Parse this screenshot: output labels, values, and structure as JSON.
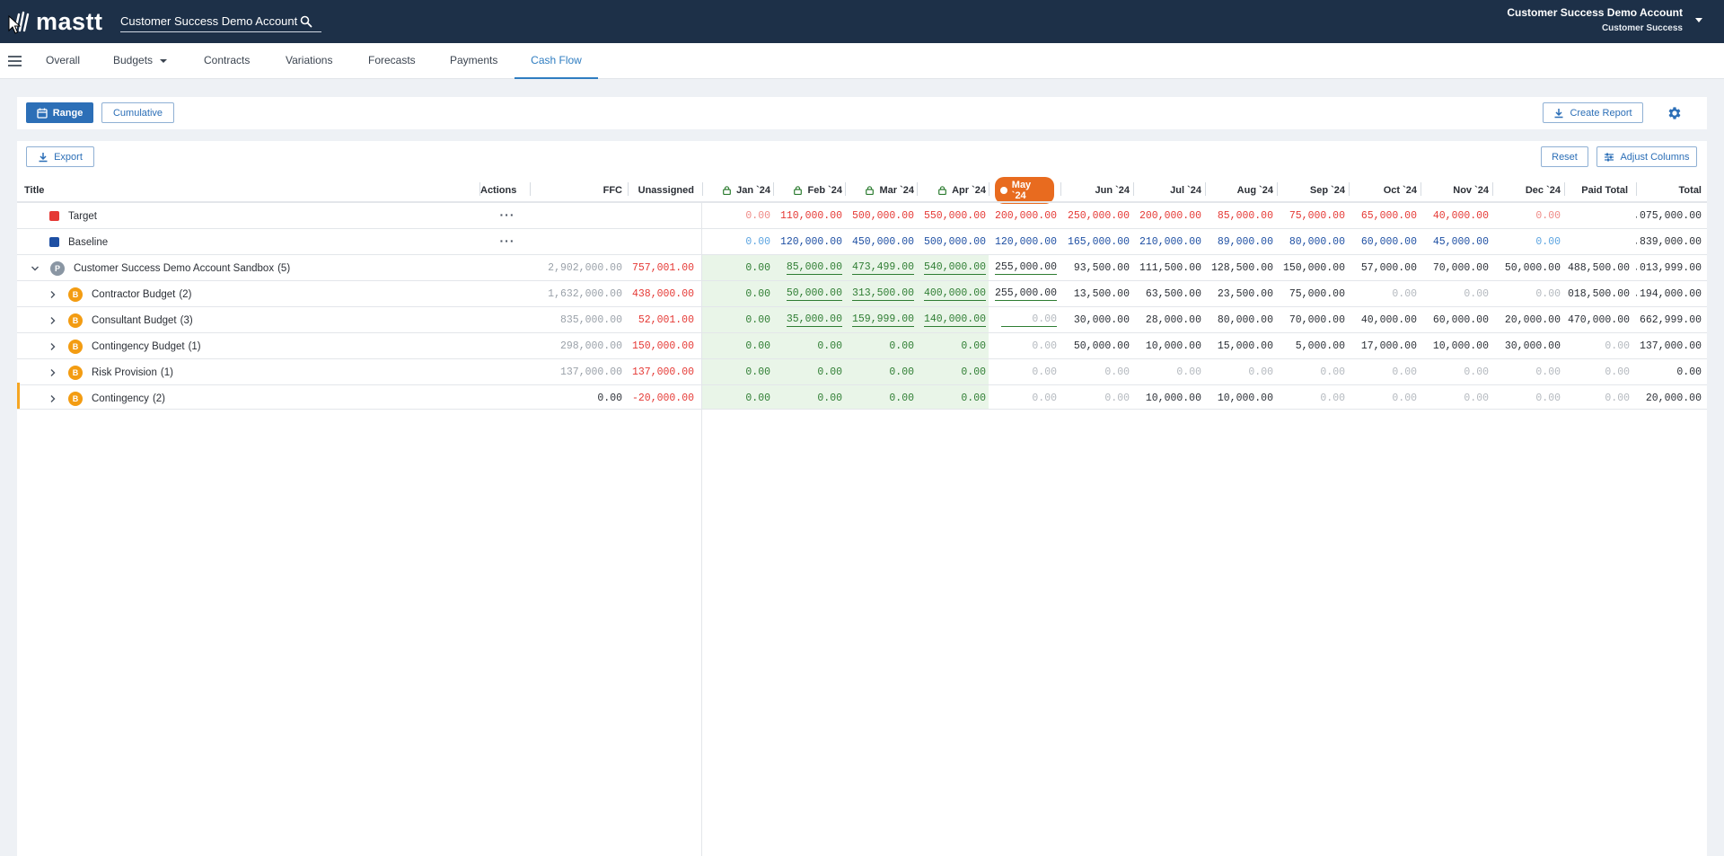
{
  "topbar": {
    "logo_text": "mastt",
    "search_value": "Customer Success Demo Account",
    "user_name": "Customer Success Demo Account",
    "user_role": "Customer Success"
  },
  "nav": {
    "tabs": [
      {
        "label": "Overall"
      },
      {
        "label": "Budgets"
      },
      {
        "label": "Contracts"
      },
      {
        "label": "Variations"
      },
      {
        "label": "Forecasts"
      },
      {
        "label": "Payments"
      },
      {
        "label": "Cash Flow"
      }
    ],
    "active_tab": "Cash Flow"
  },
  "toolbar": {
    "range_label": "Range",
    "cumulative_label": "Cumulative",
    "create_report_label": "Create Report"
  },
  "table_actions": {
    "export_label": "Export",
    "reset_label": "Reset",
    "adjust_columns_label": "Adjust Columns"
  },
  "columns": {
    "title": "Title",
    "actions": "Actions",
    "ffc": "FFC",
    "unassigned": "Unassigned",
    "months": [
      "Jan `24",
      "Feb `24",
      "Mar `24",
      "Apr `24",
      "May `24",
      "Jun `24",
      "Jul `24",
      "Aug `24",
      "Sep `24",
      "Oct `24",
      "Nov `24",
      "Dec `24"
    ],
    "paid_total": "Paid Total",
    "total": "Total"
  },
  "rows": [
    {
      "title": "Target",
      "actions": "···",
      "ffc": "",
      "unassigned": "",
      "months": [
        "0.00",
        "110,000.00",
        "500,000.00",
        "550,000.00",
        "200,000.00",
        "250,000.00",
        "200,000.00",
        "85,000.00",
        "75,000.00",
        "65,000.00",
        "40,000.00",
        "0.00"
      ],
      "paid_total": "",
      "total": ",075,000.00"
    },
    {
      "title": "Baseline",
      "actions": "···",
      "ffc": "",
      "unassigned": "",
      "months": [
        "0.00",
        "120,000.00",
        "450,000.00",
        "500,000.00",
        "120,000.00",
        "165,000.00",
        "210,000.00",
        "89,000.00",
        "80,000.00",
        "60,000.00",
        "45,000.00",
        "0.00"
      ],
      "paid_total": "",
      "total": ",839,000.00"
    },
    {
      "title": "Customer Success Demo Account Sandbox",
      "count": "(5)",
      "badge": "P",
      "ffc": "2,902,000.00",
      "unassigned": "757,001.00",
      "months": [
        "0.00",
        "85,000.00",
        "473,499.00",
        "540,000.00",
        "255,000.00",
        "93,500.00",
        "111,500.00",
        "128,500.00",
        "150,000.00",
        "57,000.00",
        "70,000.00",
        "50,000.00"
      ],
      "paid_total": ",488,500.00",
      "total": ",013,999.00"
    },
    {
      "title": "Contractor Budget",
      "count": "(2)",
      "badge": "B",
      "ffc": "1,632,000.00",
      "unassigned": "438,000.00",
      "months": [
        "0.00",
        "50,000.00",
        "313,500.00",
        "400,000.00",
        "255,000.00",
        "13,500.00",
        "63,500.00",
        "23,500.00",
        "75,000.00",
        "0.00",
        "0.00",
        "0.00"
      ],
      "paid_total": ",018,500.00",
      "total": ",194,000.00"
    },
    {
      "title": "Consultant Budget",
      "count": "(3)",
      "badge": "B",
      "ffc": "835,000.00",
      "unassigned": "52,001.00",
      "months": [
        "0.00",
        "35,000.00",
        "159,999.00",
        "140,000.00",
        "0.00",
        "30,000.00",
        "28,000.00",
        "80,000.00",
        "70,000.00",
        "40,000.00",
        "60,000.00",
        "20,000.00"
      ],
      "paid_total": "470,000.00",
      "total": "662,999.00"
    },
    {
      "title": "Contingency Budget",
      "count": "(1)",
      "badge": "B",
      "ffc": "298,000.00",
      "unassigned": "150,000.00",
      "months": [
        "0.00",
        "0.00",
        "0.00",
        "0.00",
        "0.00",
        "50,000.00",
        "10,000.00",
        "15,000.00",
        "5,000.00",
        "17,000.00",
        "10,000.00",
        "30,000.00"
      ],
      "paid_total": "0.00",
      "total": "137,000.00"
    },
    {
      "title": "Risk Provision",
      "count": "(1)",
      "badge": "B",
      "ffc": "137,000.00",
      "unassigned": "137,000.00",
      "months": [
        "0.00",
        "0.00",
        "0.00",
        "0.00",
        "0.00",
        "0.00",
        "0.00",
        "0.00",
        "0.00",
        "0.00",
        "0.00",
        "0.00"
      ],
      "paid_total": "0.00",
      "total": "0.00"
    },
    {
      "title": "Contingency",
      "count": "(2)",
      "badge": "B",
      "ffc": "0.00",
      "unassigned": "-20,000.00",
      "months": [
        "0.00",
        "0.00",
        "0.00",
        "0.00",
        "0.00",
        "0.00",
        "10,000.00",
        "10,000.00",
        "0.00",
        "0.00",
        "0.00",
        "0.00"
      ],
      "paid_total": "0.00",
      "total": "20,000.00"
    }
  ],
  "colors": {
    "topbar": "#1d3048",
    "accent": "#2f7dc1",
    "target": "#e53935",
    "baseline": "#1e4fa3",
    "actual_green": "#2e7d32",
    "today": "#e86b1f",
    "badge_project": "#8a96a3",
    "badge_budget": "#f39c12"
  }
}
